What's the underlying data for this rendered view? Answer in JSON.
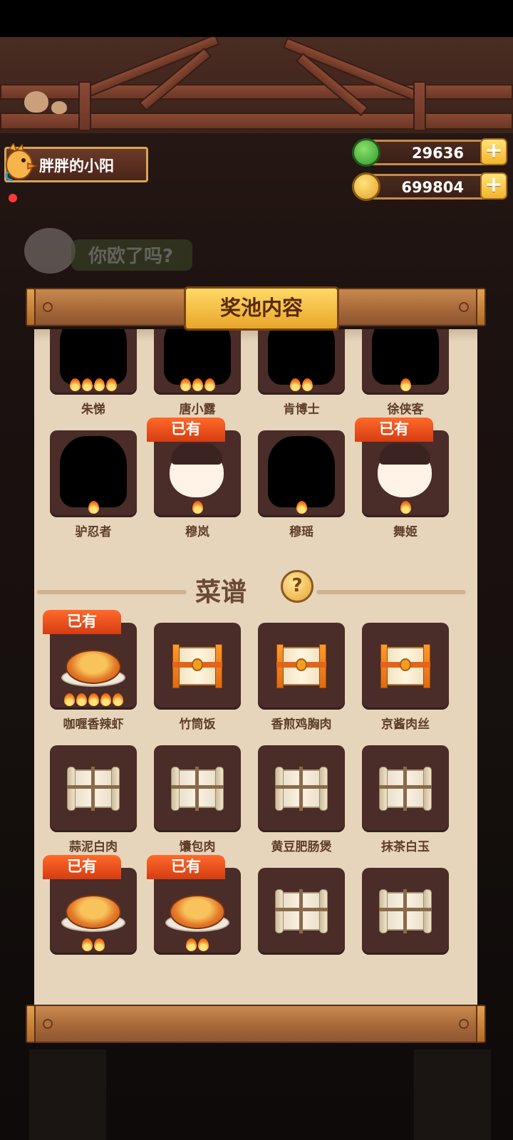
{
  "player": {
    "name": "胖胖的小阳"
  },
  "currency": [
    {
      "icon": "jade-coin-icon",
      "value": "29636"
    },
    {
      "icon": "gold-coin-icon",
      "value": "699804"
    }
  ],
  "plus_label": "+",
  "slogan": "你欧了吗?",
  "panel": {
    "title": "奖池内容",
    "characters": [
      {
        "name": "朱悌",
        "flames": 4,
        "owned": false
      },
      {
        "name": "唐小露",
        "flames": 3,
        "owned": false
      },
      {
        "name": "肯博士",
        "flames": 2,
        "owned": false
      },
      {
        "name": "徐侠客",
        "flames": 1,
        "owned": false
      },
      {
        "name": "驴忍者",
        "flames": 1,
        "owned": false
      },
      {
        "name": "穆岚",
        "flames": 1,
        "owned": true
      },
      {
        "name": "穆瑶",
        "flames": 1,
        "owned": false
      },
      {
        "name": "舞姬",
        "flames": 1,
        "owned": true
      }
    ],
    "recipe_section": {
      "title": "菜谱",
      "help_label": "?"
    },
    "recipes": [
      {
        "name": "咖喱香辣虾",
        "flames": 5,
        "owned": true,
        "image": "dish"
      },
      {
        "name": "竹筒饭",
        "flames": 0,
        "owned": false,
        "image": "gift-scroll"
      },
      {
        "name": "香煎鸡胸肉",
        "flames": 0,
        "owned": false,
        "image": "gift-scroll"
      },
      {
        "name": "京酱肉丝",
        "flames": 0,
        "owned": false,
        "image": "gift-scroll"
      },
      {
        "name": "蒜泥白肉",
        "flames": 0,
        "owned": false,
        "image": "plain-scroll"
      },
      {
        "name": "馕包肉",
        "flames": 0,
        "owned": false,
        "image": "plain-scroll"
      },
      {
        "name": "黄豆肥肠煲",
        "flames": 0,
        "owned": false,
        "image": "plain-scroll"
      },
      {
        "name": "抹茶白玉",
        "flames": 0,
        "owned": false,
        "image": "plain-scroll"
      },
      {
        "name": "",
        "flames": 2,
        "owned": true,
        "image": "dish"
      },
      {
        "name": "",
        "flames": 2,
        "owned": true,
        "image": "dish"
      },
      {
        "name": "",
        "flames": 0,
        "owned": false,
        "image": "plain-scroll"
      },
      {
        "name": "",
        "flames": 0,
        "owned": false,
        "image": "plain-scroll"
      }
    ],
    "owned_label": "已有"
  }
}
